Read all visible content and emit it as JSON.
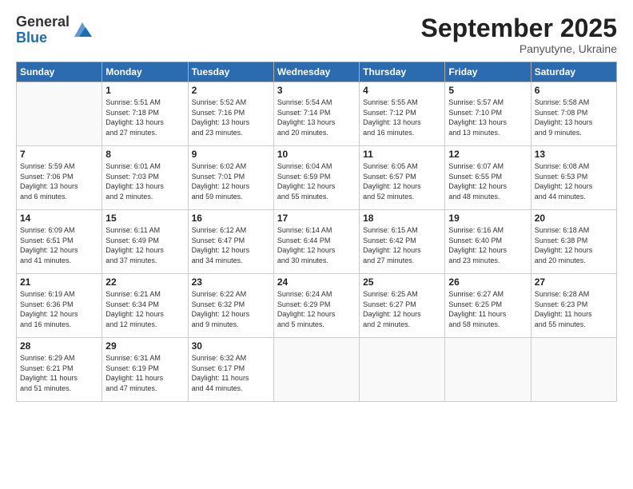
{
  "header": {
    "logo_general": "General",
    "logo_blue": "Blue",
    "month_title": "September 2025",
    "subtitle": "Panyutyne, Ukraine"
  },
  "days_of_week": [
    "Sunday",
    "Monday",
    "Tuesday",
    "Wednesday",
    "Thursday",
    "Friday",
    "Saturday"
  ],
  "weeks": [
    [
      {
        "day": "",
        "info": ""
      },
      {
        "day": "1",
        "info": "Sunrise: 5:51 AM\nSunset: 7:18 PM\nDaylight: 13 hours\nand 27 minutes."
      },
      {
        "day": "2",
        "info": "Sunrise: 5:52 AM\nSunset: 7:16 PM\nDaylight: 13 hours\nand 23 minutes."
      },
      {
        "day": "3",
        "info": "Sunrise: 5:54 AM\nSunset: 7:14 PM\nDaylight: 13 hours\nand 20 minutes."
      },
      {
        "day": "4",
        "info": "Sunrise: 5:55 AM\nSunset: 7:12 PM\nDaylight: 13 hours\nand 16 minutes."
      },
      {
        "day": "5",
        "info": "Sunrise: 5:57 AM\nSunset: 7:10 PM\nDaylight: 13 hours\nand 13 minutes."
      },
      {
        "day": "6",
        "info": "Sunrise: 5:58 AM\nSunset: 7:08 PM\nDaylight: 13 hours\nand 9 minutes."
      }
    ],
    [
      {
        "day": "7",
        "info": "Sunrise: 5:59 AM\nSunset: 7:06 PM\nDaylight: 13 hours\nand 6 minutes."
      },
      {
        "day": "8",
        "info": "Sunrise: 6:01 AM\nSunset: 7:03 PM\nDaylight: 13 hours\nand 2 minutes."
      },
      {
        "day": "9",
        "info": "Sunrise: 6:02 AM\nSunset: 7:01 PM\nDaylight: 12 hours\nand 59 minutes."
      },
      {
        "day": "10",
        "info": "Sunrise: 6:04 AM\nSunset: 6:59 PM\nDaylight: 12 hours\nand 55 minutes."
      },
      {
        "day": "11",
        "info": "Sunrise: 6:05 AM\nSunset: 6:57 PM\nDaylight: 12 hours\nand 52 minutes."
      },
      {
        "day": "12",
        "info": "Sunrise: 6:07 AM\nSunset: 6:55 PM\nDaylight: 12 hours\nand 48 minutes."
      },
      {
        "day": "13",
        "info": "Sunrise: 6:08 AM\nSunset: 6:53 PM\nDaylight: 12 hours\nand 44 minutes."
      }
    ],
    [
      {
        "day": "14",
        "info": "Sunrise: 6:09 AM\nSunset: 6:51 PM\nDaylight: 12 hours\nand 41 minutes."
      },
      {
        "day": "15",
        "info": "Sunrise: 6:11 AM\nSunset: 6:49 PM\nDaylight: 12 hours\nand 37 minutes."
      },
      {
        "day": "16",
        "info": "Sunrise: 6:12 AM\nSunset: 6:47 PM\nDaylight: 12 hours\nand 34 minutes."
      },
      {
        "day": "17",
        "info": "Sunrise: 6:14 AM\nSunset: 6:44 PM\nDaylight: 12 hours\nand 30 minutes."
      },
      {
        "day": "18",
        "info": "Sunrise: 6:15 AM\nSunset: 6:42 PM\nDaylight: 12 hours\nand 27 minutes."
      },
      {
        "day": "19",
        "info": "Sunrise: 6:16 AM\nSunset: 6:40 PM\nDaylight: 12 hours\nand 23 minutes."
      },
      {
        "day": "20",
        "info": "Sunrise: 6:18 AM\nSunset: 6:38 PM\nDaylight: 12 hours\nand 20 minutes."
      }
    ],
    [
      {
        "day": "21",
        "info": "Sunrise: 6:19 AM\nSunset: 6:36 PM\nDaylight: 12 hours\nand 16 minutes."
      },
      {
        "day": "22",
        "info": "Sunrise: 6:21 AM\nSunset: 6:34 PM\nDaylight: 12 hours\nand 12 minutes."
      },
      {
        "day": "23",
        "info": "Sunrise: 6:22 AM\nSunset: 6:32 PM\nDaylight: 12 hours\nand 9 minutes."
      },
      {
        "day": "24",
        "info": "Sunrise: 6:24 AM\nSunset: 6:29 PM\nDaylight: 12 hours\nand 5 minutes."
      },
      {
        "day": "25",
        "info": "Sunrise: 6:25 AM\nSunset: 6:27 PM\nDaylight: 12 hours\nand 2 minutes."
      },
      {
        "day": "26",
        "info": "Sunrise: 6:27 AM\nSunset: 6:25 PM\nDaylight: 11 hours\nand 58 minutes."
      },
      {
        "day": "27",
        "info": "Sunrise: 6:28 AM\nSunset: 6:23 PM\nDaylight: 11 hours\nand 55 minutes."
      }
    ],
    [
      {
        "day": "28",
        "info": "Sunrise: 6:29 AM\nSunset: 6:21 PM\nDaylight: 11 hours\nand 51 minutes."
      },
      {
        "day": "29",
        "info": "Sunrise: 6:31 AM\nSunset: 6:19 PM\nDaylight: 11 hours\nand 47 minutes."
      },
      {
        "day": "30",
        "info": "Sunrise: 6:32 AM\nSunset: 6:17 PM\nDaylight: 11 hours\nand 44 minutes."
      },
      {
        "day": "",
        "info": ""
      },
      {
        "day": "",
        "info": ""
      },
      {
        "day": "",
        "info": ""
      },
      {
        "day": "",
        "info": ""
      }
    ]
  ]
}
